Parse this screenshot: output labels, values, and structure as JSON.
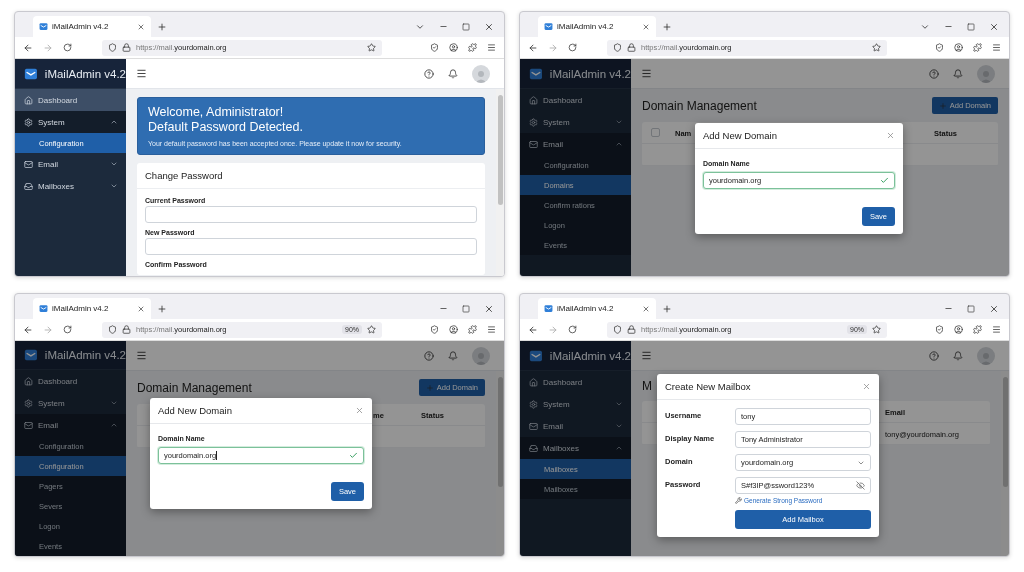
{
  "windows": [
    {
      "tab": {
        "title": "iMailAdmin v4.2",
        "list_button": true
      },
      "address": {
        "prefix": "https://mail.",
        "host": "yourdomain.org"
      },
      "scrollbar": true,
      "sidebar": {
        "brand": "iMailAdmin v4.2",
        "items": [
          {
            "label": "Dashboard",
            "selected": true
          },
          {
            "label": "System",
            "selected": false,
            "expanded": true,
            "children": [
              {
                "label": "Configuration",
                "selected": true
              }
            ]
          },
          {
            "label": "Email",
            "selected": false,
            "expanded": false
          },
          {
            "label": "Mailboxes",
            "selected": false,
            "expanded": false
          }
        ]
      },
      "page": {
        "kind": "welcome",
        "alert": {
          "title_lines": [
            "Welcome, Administrator!",
            "Default Password Detected."
          ],
          "message": "Your default password has been accepted once. Please update it now for security."
        },
        "card": {
          "title": "Change Password",
          "fields": [
            {
              "label": "Current Password",
              "input": true
            },
            {
              "label": "New Password",
              "input": true
            },
            {
              "label": "Confirm Password",
              "input": false
            }
          ]
        }
      }
    },
    {
      "tab": {
        "title": "iMailAdmin v4.2",
        "list_button": true
      },
      "address": {
        "prefix": "https://mail.",
        "host": "yourdomain.org"
      },
      "scrollbar": false,
      "sidebar": {
        "brand": "iMailAdmin v4.2",
        "items": [
          {
            "label": "Dashboard",
            "selected": false
          },
          {
            "label": "System",
            "selected": false,
            "expanded": false
          },
          {
            "label": "Email",
            "selected": false,
            "expanded": true,
            "children": [
              {
                "label": "Configuration",
                "selected": false
              },
              {
                "label": "Domains",
                "selected": true
              },
              {
                "label": "Confirm rations",
                "selected": false
              },
              {
                "label": "Logon",
                "selected": false
              },
              {
                "label": "Events",
                "selected": false
              }
            ]
          }
        ]
      },
      "page": {
        "kind": "domains",
        "heading": "Domain Management",
        "add_button": "Add Domain",
        "table": {
          "checkbox": {
            "checked": false
          },
          "columns": [
            "Nam",
            "Status"
          ]
        }
      },
      "modal": {
        "kind": "stacked",
        "title": "Add New Domain",
        "fields": [
          {
            "kind": "text",
            "label": "Domain Name",
            "value": "yourdomain.org",
            "valid": true,
            "caret": false
          }
        ],
        "button": "Save"
      }
    },
    {
      "tab": {
        "title": "iMailAdmin v4.2",
        "list_button": false
      },
      "address": {
        "prefix": "https://mail.",
        "host": "yourdomain.org",
        "zoom": "90%"
      },
      "scrollbar": true,
      "sidebar": {
        "brand": "iMailAdmin v4.2",
        "items": [
          {
            "label": "Dashboard",
            "selected": false
          },
          {
            "label": "System",
            "selected": false,
            "expanded": false
          },
          {
            "label": "Email",
            "selected": false,
            "expanded": true,
            "children": [
              {
                "label": "Configuration",
                "selected": false
              },
              {
                "label": "Configuration",
                "selected": true
              },
              {
                "label": "Pagers",
                "selected": false
              },
              {
                "label": "Severs",
                "selected": false
              },
              {
                "label": "Logon",
                "selected": false
              },
              {
                "label": "Events",
                "selected": false
              }
            ]
          }
        ]
      },
      "page": {
        "kind": "domains",
        "heading": "Domain Management",
        "add_button": "Add Domain",
        "table": {
          "columns": [
            "me",
            "Status"
          ]
        }
      },
      "modal": {
        "kind": "stacked",
        "title": "Add New Domain",
        "fields": [
          {
            "kind": "text",
            "label": "Domain Name",
            "value": "yourdomain.org",
            "valid": true,
            "caret": true
          }
        ],
        "button": "Save"
      }
    },
    {
      "tab": {
        "title": "iMailAdmin v4.2",
        "list_button": false
      },
      "address": {
        "prefix": "https://mail.",
        "host": "yourdomain.org",
        "zoom": "90%"
      },
      "scrollbar": true,
      "sidebar": {
        "brand": "iMailAdmin v4.2",
        "items": [
          {
            "label": "Dashboard",
            "selected": false
          },
          {
            "label": "System",
            "selected": false,
            "expanded": false
          },
          {
            "label": "Email",
            "selected": false,
            "expanded": false
          },
          {
            "label": "Mailboxes",
            "selected": false,
            "expanded": true,
            "children": [
              {
                "label": "Mailboxes",
                "selected": true
              },
              {
                "label": "Mailboxes",
                "selected": false
              }
            ]
          }
        ]
      },
      "page": {
        "kind": "mailboxes",
        "heading": "M",
        "table": {
          "columns": [
            "Email"
          ],
          "rows": [
            {
              "cells": [
                "tony@yourdomain.org"
              ]
            }
          ]
        }
      },
      "modal": {
        "kind": "inline",
        "title": "Create New Mailbox",
        "fields": [
          {
            "kind": "text",
            "label": "Username",
            "value": "tony",
            "valid": false
          },
          {
            "kind": "text",
            "label": "Display Name",
            "value": "Tony Administrator",
            "valid": false
          },
          {
            "kind": "select",
            "label": "Domain",
            "value": "yourdomain.org",
            "valid": false
          },
          {
            "kind": "password",
            "label": "Password",
            "value": "S#f3IP@ssword123%",
            "valid": false,
            "link": "Generate Strong Password"
          }
        ],
        "button": "Add Mailbox"
      }
    }
  ]
}
